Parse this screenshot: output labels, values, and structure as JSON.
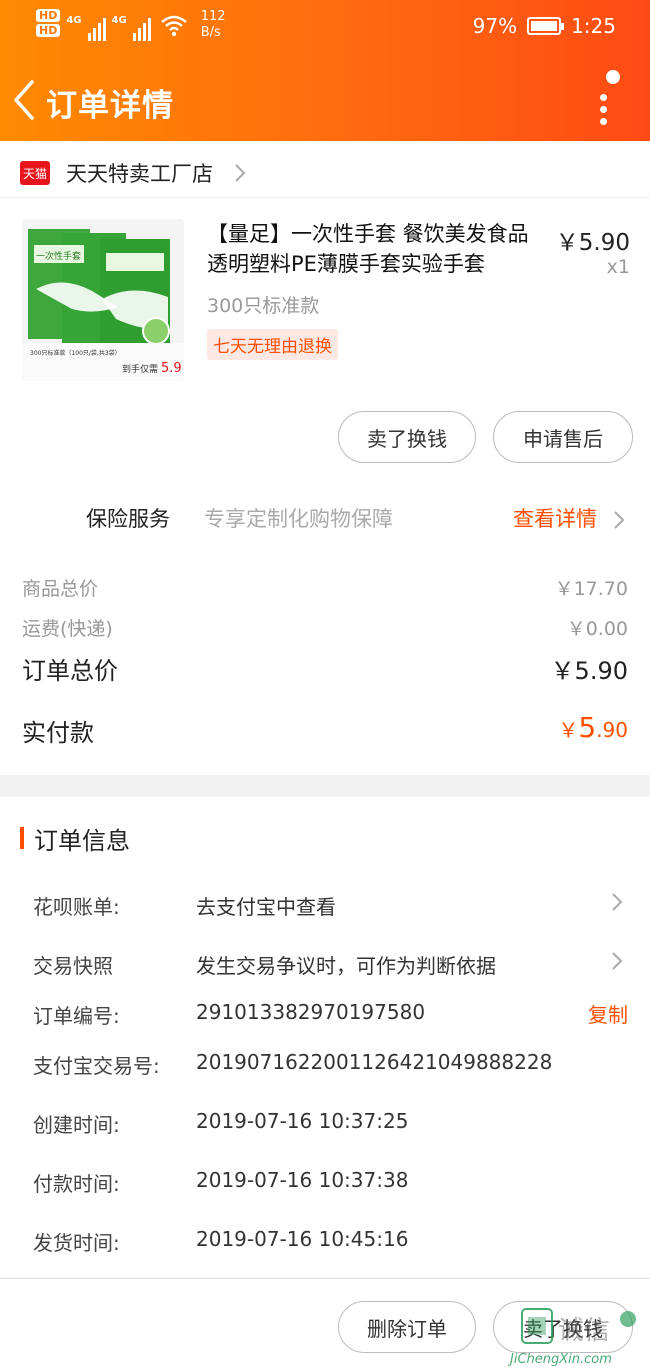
{
  "status_bar": {
    "hd1": "HD",
    "hd2": "HD",
    "net_type1": "4G",
    "net_type2": "4G",
    "speed_value": "112",
    "speed_unit": "B/s",
    "battery": "97%",
    "time": "1:25"
  },
  "nav": {
    "title": "订单详情"
  },
  "shop": {
    "badge": "天猫",
    "name": "天天特卖工厂店"
  },
  "product": {
    "name": "【量足】一次性手套 餐饮美发食品透明塑料PE薄膜手套实验手套",
    "price": "￥5.90",
    "quantity": "x1",
    "sku": "300只标准款",
    "return_policy": "七天无理由退换",
    "image_text_top": "一次性手套",
    "image_text_small": "300只标准款（100只/袋,共3袋）",
    "image_text_price": "到手仅需",
    "image_price_value": "5.9"
  },
  "actions": {
    "sell_label": "卖了换钱",
    "after_sale_label": "申请售后"
  },
  "insurance": {
    "label": "保险服务",
    "description": "专享定制化购物保障",
    "link": "查看详情"
  },
  "summary": {
    "goods_total_label": "商品总价",
    "goods_total_value": "￥17.70",
    "shipping_label": "运费(快递)",
    "shipping_value": "￥0.00",
    "order_total_label": "订单总价",
    "order_total_value": "￥5.90",
    "paid_label": "实付款",
    "paid_currency": "￥",
    "paid_int": "5",
    "paid_dec": ".90"
  },
  "order_info": {
    "title": "订单信息",
    "huabei_label": "花呗账单:",
    "huabei_value": "去支付宝中查看",
    "snapshot_label": "交易快照",
    "snapshot_value": "发生交易争议时，可作为判断依据",
    "order_no_label": "订单编号:",
    "order_no_value": "291013382970197580",
    "copy_label": "复制",
    "alipay_label": "支付宝交易号:",
    "alipay_value": "2019071622001126421049888228",
    "created_label": "创建时间:",
    "created_value": "2019-07-16 10:37:25",
    "paid_time_label": "付款时间:",
    "paid_time_value": "2019-07-16 10:37:38",
    "ship_time_label": "发货时间:",
    "ship_time_value": "2019-07-16 10:45:16"
  },
  "footer": {
    "delete_label": "删除订单",
    "sell_label": "卖了换钱"
  },
  "watermark": {
    "text": "诚信",
    "url": "JiChengXin.com"
  },
  "colors": {
    "accent": "#ff5000",
    "header_start": "#ff8a00",
    "header_end": "#ff4a14",
    "tmall_red": "#e8151d"
  }
}
